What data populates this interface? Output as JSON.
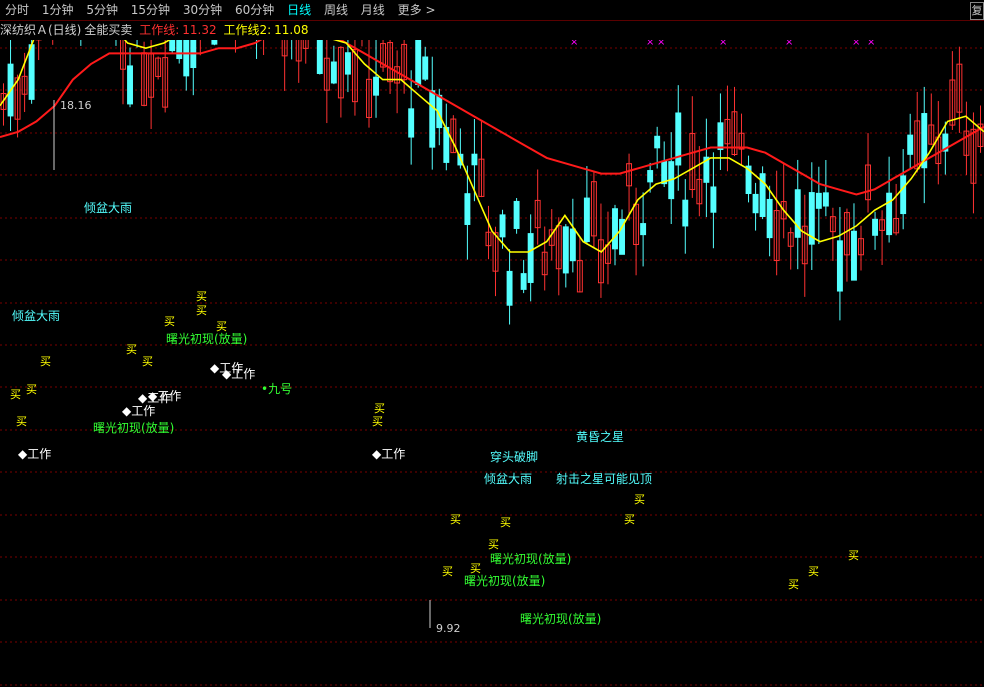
{
  "toolbar": {
    "periods": [
      {
        "label": "分时",
        "active": false
      },
      {
        "label": "1分钟",
        "active": false
      },
      {
        "label": "5分钟",
        "active": false
      },
      {
        "label": "15分钟",
        "active": false
      },
      {
        "label": "30分钟",
        "active": false
      },
      {
        "label": "60分钟",
        "active": false
      },
      {
        "label": "日线",
        "active": true
      },
      {
        "label": "周线",
        "active": false
      },
      {
        "label": "月线",
        "active": false
      }
    ],
    "more_label": "更多 >",
    "right_button_label": "复"
  },
  "info": {
    "stock_name": "深纺织Ａ(日线)",
    "indicator_name": "全能买卖",
    "work_line_1_label": "工作线:",
    "work_line_1_value": "11.32",
    "work_line_2_label": "工作线2:",
    "work_line_2_value": "11.08"
  },
  "colors": {
    "background": "#000000",
    "up_candle": "#ff3232",
    "down_candle": "#54ffff",
    "line_1": "#ff1a1a",
    "line_2": "#ffff00",
    "grid": "#7a0000",
    "buy_label": "#ffff00",
    "pattern_label_cyan": "#54ffff",
    "pattern_label_green": "#33ff33",
    "work_label": "#ffffff",
    "top_marker": "#ff00ff"
  },
  "chart_data": {
    "type": "candlestick",
    "series": [
      {
        "name": "工作线",
        "values": [
          10.2,
          10.3,
          10.5,
          10.8,
          11.3,
          11.6,
          11.8,
          11.8,
          11.8,
          11.8,
          11.8,
          11.8,
          11.9,
          11.9,
          12.0,
          12.2,
          12.3,
          12.3,
          12.2,
          12.0,
          11.8,
          11.6,
          11.4,
          11.2,
          11.0,
          10.8,
          10.6,
          10.4,
          10.2,
          10.0,
          9.8,
          9.7,
          9.6,
          9.5,
          9.5,
          9.6,
          9.7,
          9.8,
          9.9,
          10.0,
          10.0,
          10.0,
          9.9,
          9.7,
          9.5,
          9.3,
          9.2,
          9.1,
          9.2,
          9.4,
          9.6,
          9.8,
          10.0,
          10.2,
          10.4
        ]
      },
      {
        "name": "工作线2",
        "values": [
          10.8,
          11.3,
          12.2,
          13.3,
          13.6,
          13.0,
          12.4,
          12.0,
          11.9,
          12.0,
          12.2,
          12.6,
          12.9,
          12.9,
          12.8,
          12.6,
          12.4,
          12.2,
          12.1,
          12.0,
          11.6,
          11.3,
          11.3,
          11.0,
          10.7,
          10.0,
          9.2,
          8.4,
          8.0,
          8.0,
          8.2,
          8.7,
          8.2,
          8.0,
          8.4,
          9.0,
          9.3,
          9.4,
          9.6,
          9.8,
          9.8,
          9.6,
          9.3,
          8.8,
          8.4,
          8.2,
          8.3,
          8.5,
          8.8,
          9.0,
          9.4,
          9.9,
          10.5,
          10.6,
          10.3
        ]
      },
      {
        "name": "K",
        "close": [
          10.4,
          11.1,
          12.2,
          14.5,
          15.7,
          13.6,
          12.8,
          11.2,
          11.9,
          12.3,
          12.6,
          13.1,
          13.2,
          13.4,
          12.7,
          12.5,
          12.1,
          12.0,
          11.7,
          11.2,
          11.4,
          10.8,
          10.6,
          10.1,
          10.7,
          9.9,
          8.6,
          7.6,
          7.4,
          8.2,
          8.4,
          8.9,
          8.5,
          7.9,
          7.9,
          8.5,
          9.1,
          9.5,
          9.6,
          9.7,
          9.3,
          9.7,
          9.2,
          8.8,
          8.2,
          7.9,
          8.6,
          8.4,
          8.0,
          8.9,
          9.4,
          10.1,
          10.5,
          10.7,
          10.1
        ]
      }
    ],
    "price_labels": {
      "high": "18.16",
      "low": "9.92"
    },
    "annotations": [
      {
        "text": "倾盆大雨",
        "kind": "cyan"
      },
      {
        "text": "倾盆大雨",
        "kind": "cyan"
      },
      {
        "text": "曙光初现(放量)",
        "kind": "green"
      },
      {
        "text": "曙光初现(放量)",
        "kind": "green"
      },
      {
        "text": "九号",
        "kind": "green"
      },
      {
        "text": "穿头破脚",
        "kind": "cyan"
      },
      {
        "text": "倾盆大雨",
        "kind": "cyan"
      },
      {
        "text": "黄昏之星",
        "kind": "cyan"
      },
      {
        "text": "射击之星可能见顶",
        "kind": "cyan"
      },
      {
        "text": "曙光初现(放量)",
        "kind": "green"
      },
      {
        "text": "曙光初现(放量)",
        "kind": "green"
      },
      {
        "text": "曙光初现(放量)",
        "kind": "green"
      }
    ],
    "work_signals": [
      "工作",
      "工作",
      "工作",
      "工作",
      "工作",
      "工作",
      "工作"
    ],
    "buy_signals": [
      "买",
      "买",
      "买",
      "买",
      "买",
      "买",
      "买",
      "买",
      "买",
      "买",
      "买",
      "买",
      "买",
      "买",
      "买",
      "买",
      "买",
      "买",
      "买",
      "买",
      "买",
      "买"
    ],
    "top_markers": [
      "×",
      "×",
      "×",
      "×",
      "×",
      "×",
      "×"
    ]
  }
}
